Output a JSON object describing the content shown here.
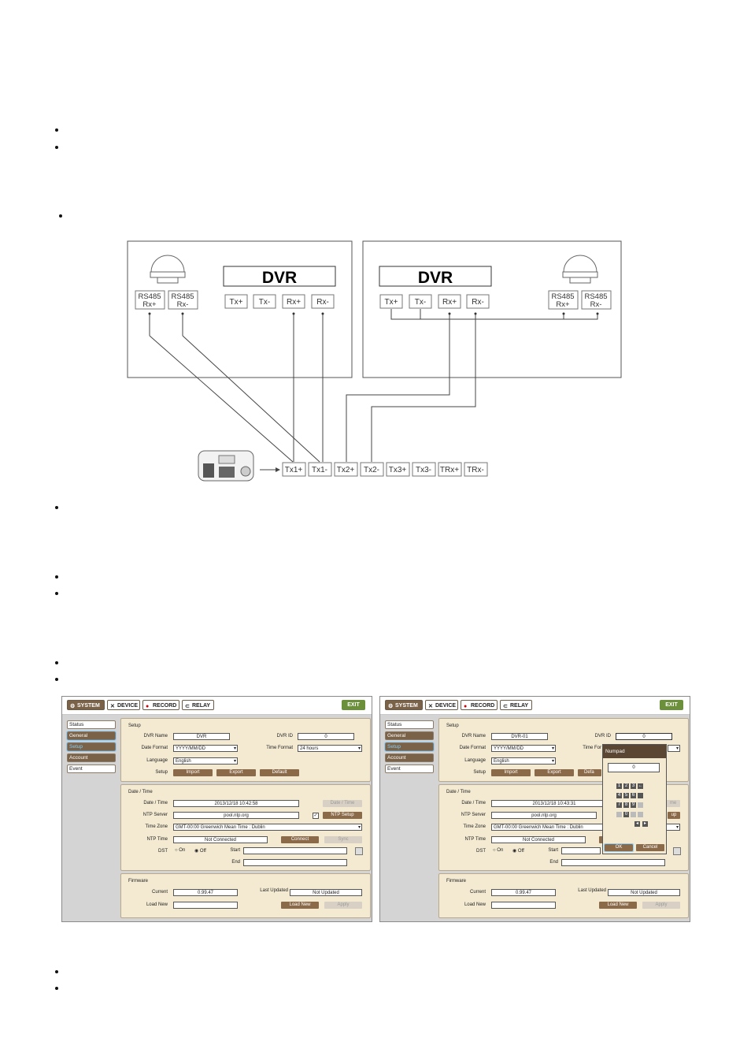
{
  "diagram": {
    "left_dvr_label": "DVR",
    "right_dvr_label": "DVR",
    "left_camera_ports": [
      "RS485\nRx+",
      "RS485\nRx-"
    ],
    "right_camera_ports": [
      "RS485\nRx+",
      "RS485\nRx-"
    ],
    "left_dvr_ports": [
      "Tx+",
      "Tx-",
      "Rx+",
      "Rx-"
    ],
    "right_dvr_ports": [
      "Tx+",
      "Tx-",
      "Rx+",
      "Rx-"
    ],
    "controller_ports": [
      "Tx1+",
      "Tx1-",
      "Tx2+",
      "Tx2-",
      "Tx3+",
      "Tx3-",
      "TRx+",
      "TRx-"
    ]
  },
  "menu": {
    "tabs": [
      "SYSTEM",
      "DEVICE",
      "RECORD",
      "RELAY"
    ],
    "exit": "EXIT",
    "sidebar": [
      "Status",
      "General",
      "Setup",
      "Account",
      "Event"
    ]
  },
  "left_screen": {
    "setup_title": "Setup",
    "dvr_name_label": "DVR Name",
    "dvr_name": "DVR",
    "dvr_id_label": "DVR ID",
    "dvr_id": "0",
    "date_format_label": "Date Format",
    "date_format": "YYYY/MM/DD",
    "time_format_label": "Time Format",
    "time_format": "24 hours",
    "language_label": "Language",
    "language": "English",
    "setup_label": "Setup",
    "import": "Import",
    "export": "Export",
    "default": "Default",
    "datetime_title": "Date / Time",
    "datetime_label": "Date / Time",
    "datetime": "2013/12/18  10:42:58",
    "datetime_btn": "Date / Time",
    "ntp_server_label": "NTP Server",
    "ntp_server": "pool.ntp.org",
    "ntp_setup": "NTP Setup",
    "time_zone_label": "Time Zone",
    "time_zone": "GMT-00:00 Greenwich Mean Time : Dublin",
    "ntp_time_label": "NTP Time",
    "ntp_time": "Not Connected",
    "connect": "Connect",
    "sync": "Sync",
    "dst_label": "DST",
    "on": "On",
    "off": "Off",
    "start_label": "Start",
    "end_label": "End",
    "firmware_title": "Firmware",
    "current_label": "Current",
    "current": "0.99.47",
    "last_updated_label": "Last Updated",
    "last_updated": "Not Updated",
    "load_new_label": "Load New",
    "load_new_btn": "Load New",
    "apply": "Apply"
  },
  "right_screen": {
    "dvr_name": "DVR-01",
    "dvr_id": "0",
    "time_format_label": "Time For",
    "default": "Defa",
    "datetime_btn": "me",
    "datetime": "2013/12/18  10:43:31",
    "ntp_setup": "up",
    "numpad_title": "Numpad",
    "numpad_value": "0",
    "keys": [
      "1",
      "2",
      "3",
      "←",
      "4",
      "5",
      "6",
      "",
      "7",
      "8",
      "9",
      "",
      "",
      "0",
      "",
      ""
    ],
    "ok": "OK",
    "cancel": "Cancel"
  }
}
